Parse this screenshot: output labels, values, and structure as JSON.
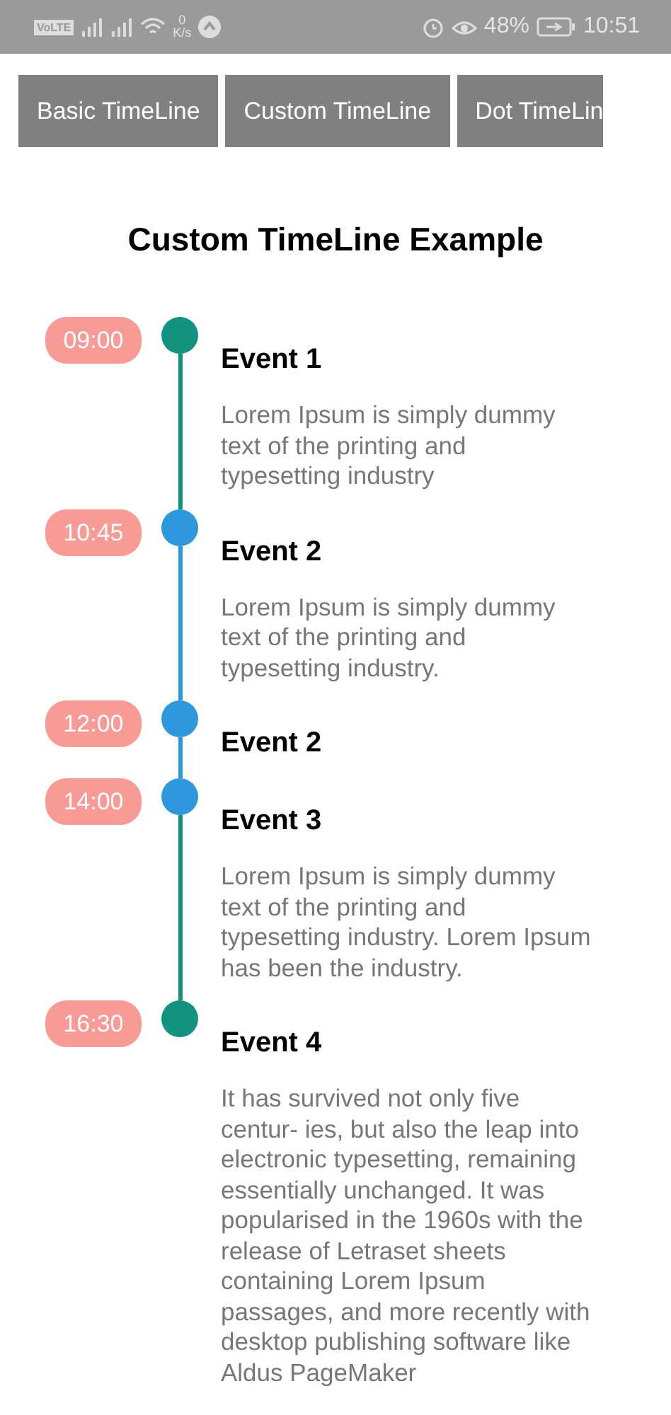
{
  "status_bar": {
    "volte": "VoLTE",
    "speed_value": "0",
    "speed_unit": "K/s",
    "battery": "48%",
    "time": "10:51"
  },
  "tabs": [
    {
      "label": "Basic TimeLine",
      "selected": false
    },
    {
      "label": "Custom TimeLine",
      "selected": false
    },
    {
      "label": "Dot TimeLin",
      "selected": false
    }
  ],
  "title": "Custom TimeLine Example",
  "events": [
    {
      "time": "09:00",
      "title": "Event 1",
      "description": "Lorem Ipsum is simply dummy text of the printing and typesetting industry",
      "color": "#12927f",
      "line": {
        "color": "#12927f"
      }
    },
    {
      "time": "10:45",
      "title": "Event 2",
      "description": "Lorem Ipsum is simply dummy text of the printing and typesetting industry.",
      "color": "#2f97dc",
      "line": {
        "color": "#2f97dc"
      }
    },
    {
      "time": "12:00",
      "title": "Event 2",
      "color": "#2f97dc",
      "line": {
        "color": "#2f97dc"
      }
    },
    {
      "time": "14:00",
      "title": "Event 3",
      "description": "Lorem Ipsum is simply dummy text of the printing and typesetting industry. Lorem Ipsum has been the industry.",
      "color": "#2f97dc",
      "line": {
        "color": "#12927f"
      }
    },
    {
      "time": "16:30",
      "title": "Event 4",
      "description": "It has survived not only five centur- ies, but also the leap into electronic typesetting, remaining essentially unchanged. It was popularised in the 1960s with the release of Letraset sheets containing Lorem Ipsum passages, and more recently with desktop publishing software like Aldus PageMaker",
      "color": "#12927f"
    }
  ]
}
